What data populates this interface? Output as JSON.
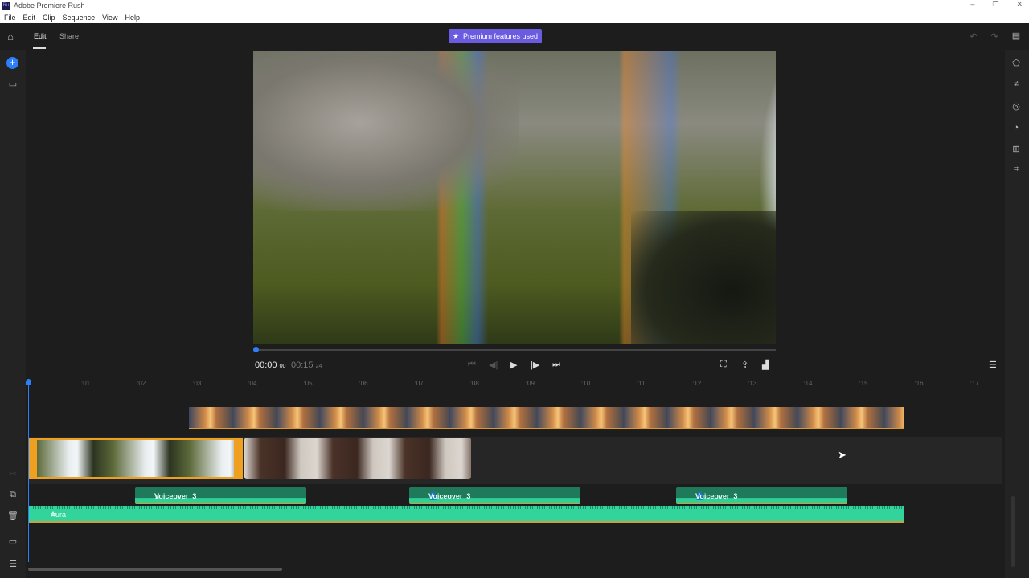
{
  "app": {
    "title": "Adobe Premiere Rush",
    "logo": "Ru"
  },
  "window_controls": [
    "–",
    "❐",
    "✕"
  ],
  "menu": [
    "File",
    "Edit",
    "Clip",
    "Sequence",
    "View",
    "Help"
  ],
  "tabs": {
    "edit": "Edit",
    "share": "Share"
  },
  "premium": {
    "icon": "★",
    "label": "Premium features used"
  },
  "player": {
    "current": "00:00",
    "current_frames": "00",
    "duration": "00:15",
    "duration_frames": "24",
    "progress": 0
  },
  "ruler": [
    ":01",
    ":02",
    ":03",
    ":04",
    ":05",
    ":06",
    ":07",
    ":08",
    ":09",
    ":10",
    ":11",
    ":12",
    ":13",
    ":14",
    ":15",
    ":16",
    ":17"
  ],
  "tracks": {
    "voiceovers": [
      "Voiceover_3",
      "Voiceover_3",
      "Voiceover_3"
    ],
    "music": "Aura"
  },
  "colors": {
    "accent": "#2d7ff9",
    "premium": "#6a5be0",
    "audio": "#33d39c",
    "selected": "#f0a020"
  }
}
